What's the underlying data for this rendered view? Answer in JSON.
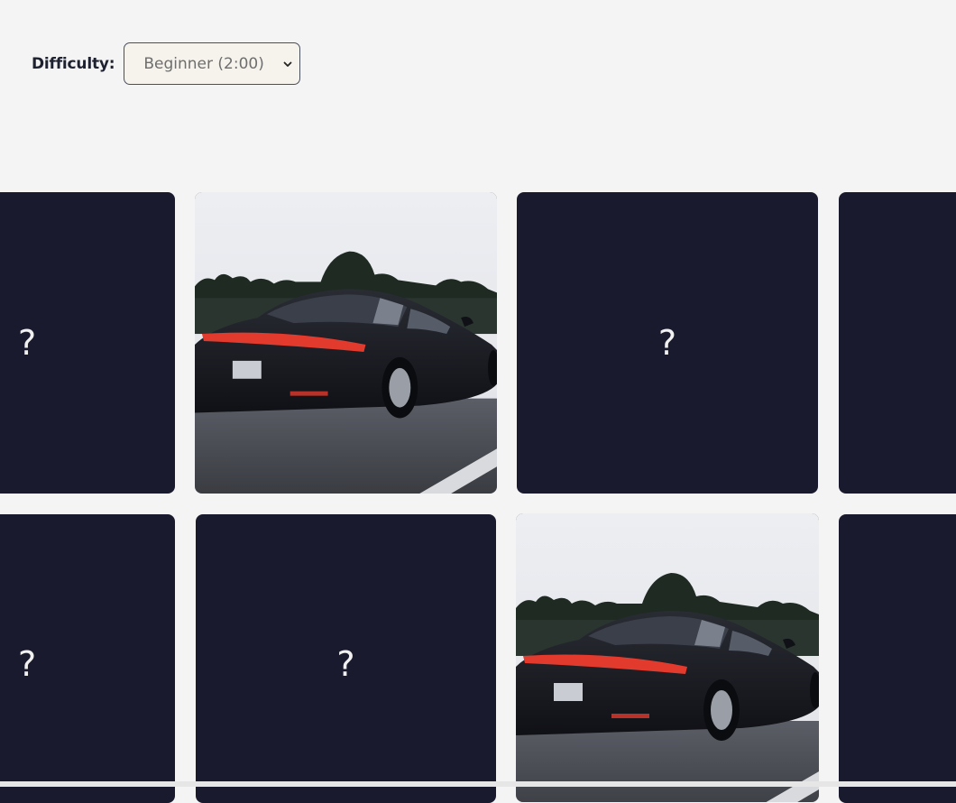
{
  "difficulty": {
    "label": "Difficulty:",
    "selected": "Beginner (2:00)"
  },
  "board": {
    "cards": [
      {
        "row": 1,
        "col": 1,
        "state": "hidden",
        "face": "?"
      },
      {
        "row": 1,
        "col": 2,
        "state": "revealed",
        "image": "black-sedan-photo"
      },
      {
        "row": 1,
        "col": 3,
        "state": "hidden",
        "face": "?"
      },
      {
        "row": 1,
        "col": 4,
        "state": "hidden",
        "face": ""
      },
      {
        "row": 2,
        "col": 1,
        "state": "hidden",
        "face": "?"
      },
      {
        "row": 2,
        "col": 2,
        "state": "hidden",
        "face": "?"
      },
      {
        "row": 2,
        "col": 3,
        "state": "revealed",
        "image": "black-sedan-photo"
      },
      {
        "row": 2,
        "col": 4,
        "state": "hidden",
        "face": ""
      }
    ]
  },
  "colors": {
    "card_back": "#1a1a2e",
    "page_background": "#f4f4f4",
    "select_background": "#f6f3ec"
  }
}
